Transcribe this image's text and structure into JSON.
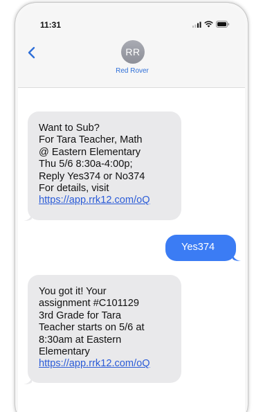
{
  "status_bar": {
    "time": "11:31",
    "icons": [
      "signal-icon",
      "wifi-icon",
      "battery-icon"
    ]
  },
  "header": {
    "back_icon": "chevron-left-icon",
    "avatar_initials": "RR",
    "contact_name": "Red Rover"
  },
  "messages": [
    {
      "direction": "incoming",
      "lines": [
        "Want to Sub?",
        "For Tara Teacher, Math",
        "@ Eastern Elementary",
        "Thu 5/6 8:30a-4:00p;",
        "Reply Yes374 or No374",
        "For details, visit"
      ],
      "link": "https://app.rrk12.com/oQ"
    },
    {
      "direction": "outgoing",
      "text": "Yes374"
    },
    {
      "direction": "incoming",
      "lines": [
        "You got it!  Your",
        "assignment #C101129",
        "3rd Grade for Tara",
        "Teacher starts on 5/6 at",
        "8:30am at Eastern",
        "Elementary"
      ],
      "link": "https://app.rrk12.com/oQ"
    }
  ],
  "colors": {
    "incoming_bubble": "#e9e9eb",
    "outgoing_bubble": "#3b7cf4",
    "link": "#2a5bd7",
    "accent": "#2e6fd8"
  }
}
